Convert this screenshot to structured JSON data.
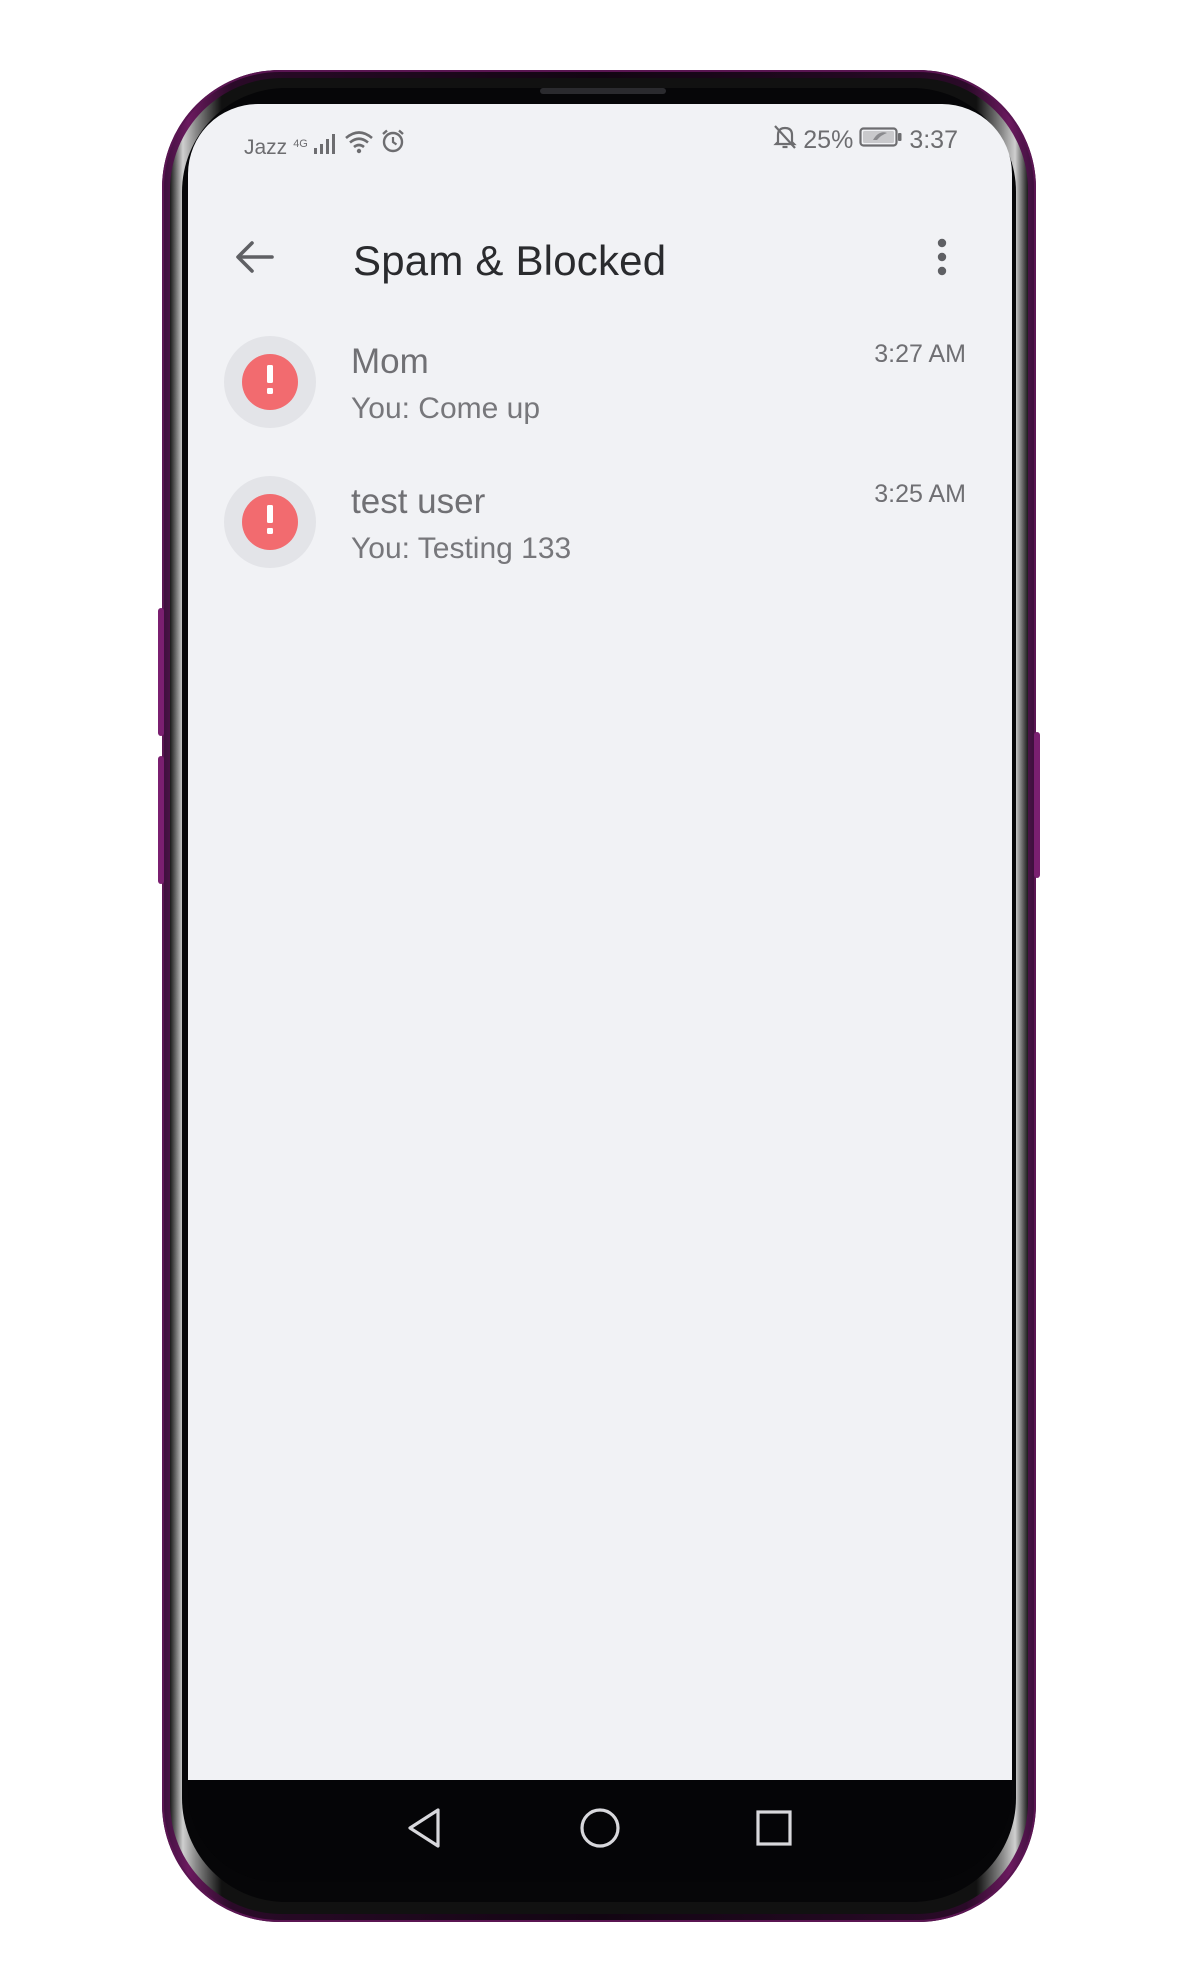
{
  "status_bar": {
    "carrier": "Jazz",
    "network": "4G",
    "battery_percent": "25%",
    "time": "3:37",
    "icons": [
      "signal-icon",
      "wifi-icon",
      "alarm-icon",
      "mute-bell-icon",
      "battery-icon"
    ]
  },
  "app_bar": {
    "title": "Spam & Blocked",
    "back_icon": "arrow-back-icon",
    "more_icon": "more-vert-icon"
  },
  "conversations": [
    {
      "name": "Mom",
      "snippet": "You: Come up",
      "time": "3:27 AM",
      "avatar_icon": "exclamation-icon"
    },
    {
      "name": "test user",
      "snippet": "You: Testing 133",
      "time": "3:25 AM",
      "avatar_icon": "exclamation-icon"
    }
  ],
  "nav_bar": {
    "icons": [
      "back-triangle-icon",
      "home-circle-icon",
      "recents-square-icon"
    ]
  },
  "colors": {
    "screen_bg": "#f1f2f5",
    "avatar_ring": "#e3e4e8",
    "avatar_alert": "#f26b6f",
    "title_text": "#2a2b2e",
    "secondary_text": "#707074",
    "phone_frame": "#6b1a5f"
  }
}
